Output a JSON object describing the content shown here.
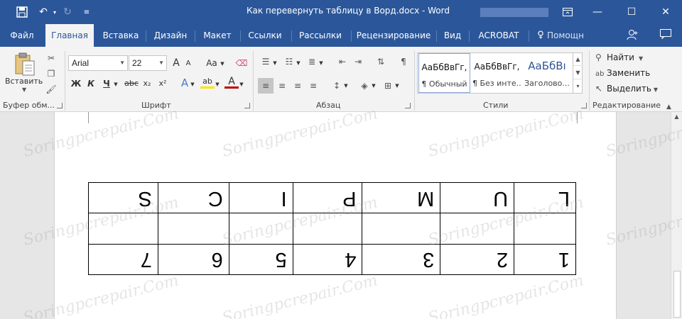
{
  "window": {
    "title": "Как перевернуть таблицу в Ворд.docx - Word"
  },
  "tabs": [
    {
      "label": "Файл"
    },
    {
      "label": "Главная"
    },
    {
      "label": "Вставка"
    },
    {
      "label": "Дизайн"
    },
    {
      "label": "Макет"
    },
    {
      "label": "Ссылки"
    },
    {
      "label": "Рассылки"
    },
    {
      "label": "Рецензирование"
    },
    {
      "label": "Вид"
    },
    {
      "label": "ACROBAT"
    },
    {
      "label": "Помощн"
    }
  ],
  "ribbon": {
    "clipboard": {
      "paste_label": "Вставить",
      "group_label": "Буфер обм..."
    },
    "font": {
      "name": "Arial",
      "size": "22",
      "group_label": "Шрифт",
      "bold": "Ж",
      "italic": "К",
      "underline": "Ч",
      "strike": "abc",
      "subscript": "x₂",
      "superscript": "x²",
      "grow": "A",
      "shrink": "A",
      "case": "Aa",
      "text_effects": "A",
      "highlight": "ab",
      "font_color": "A"
    },
    "paragraph": {
      "group_label": "Абзац"
    },
    "styles": {
      "group_label": "Стили",
      "items": [
        {
          "sample": "АаБбВвГг,",
          "name": "¶ Обычный"
        },
        {
          "sample": "АаБбВвГг,",
          "name": "¶ Без инте..."
        },
        {
          "sample": "АаБбВı",
          "name": "Заголово..."
        }
      ]
    },
    "editing": {
      "group_label": "Редактирование",
      "find": "Найти",
      "replace": "Заменить",
      "select": "Выделить"
    }
  },
  "table": {
    "rows": [
      [
        "1",
        "2",
        "3",
        "4",
        "5",
        "6",
        "7"
      ],
      [
        "",
        "",
        "",
        "",
        "",
        "",
        ""
      ],
      [
        "L",
        "U",
        "M",
        "P",
        "I",
        "C",
        "S"
      ]
    ]
  },
  "watermark": "Soringpcrepair.Com",
  "colors": {
    "word_blue": "#2b579a",
    "ribbon_bg": "#f3f3f3",
    "canvas_bg": "#e6e6e6"
  }
}
